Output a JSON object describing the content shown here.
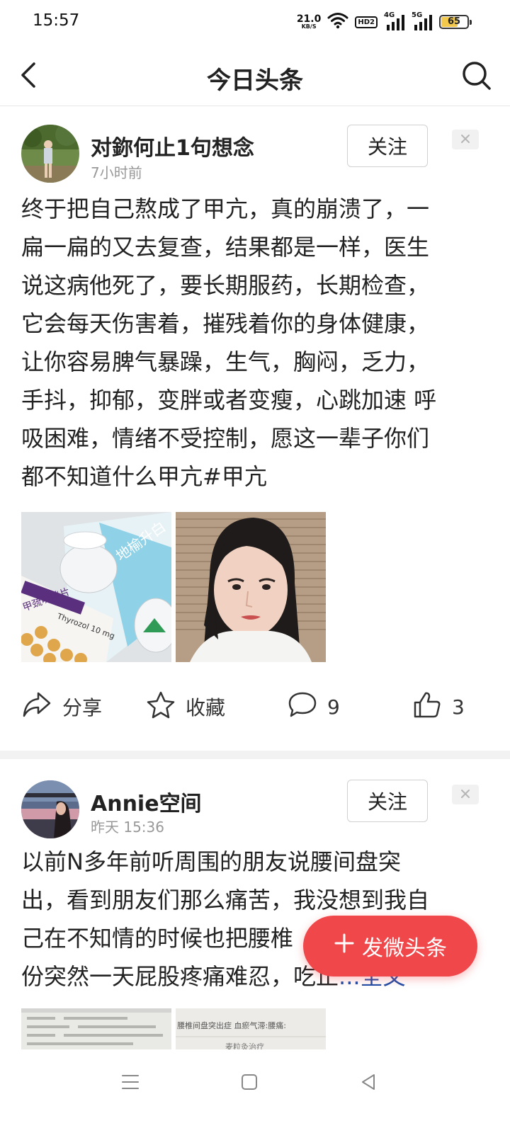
{
  "status_bar": {
    "time": "15:57",
    "net_speed": "21.0",
    "net_speed_unit": "KB/S",
    "hd_label": "HD2",
    "signal1_label": "4G",
    "signal2_label": "5G",
    "battery": "65"
  },
  "header": {
    "title": "今日头条",
    "back_icon": "chevron-left-icon",
    "search_icon": "search-icon"
  },
  "posts": [
    {
      "author": "对鉨何止1句想念",
      "time": "7小时前",
      "follow_label": "关注",
      "text_lines": [
        "终于把自己熬成了甲亢，真的崩溃了，一",
        "扁一扁的又去复查，结果都是一样，医生",
        "说这病他死了，要长期服药，长期检查，",
        "它会每天伤害着，摧残着你的身体健康，",
        "让你容易脾气暴躁，生气，胸闷，乏力，",
        "手抖，抑郁，变胖或者变瘦，心跳加速 呼",
        "吸困难，情绪不受控制，愿这一辈子你们",
        "都不知道什么甲亢#甲亢"
      ],
      "images": [
        {
          "name": "medicine-photo",
          "text1": "地榆升白",
          "text2": "甲巯咪唑片",
          "text3": "Thyrozol 10 mg"
        },
        {
          "name": "selfie-photo"
        }
      ],
      "actions": {
        "share": "分享",
        "favorite": "收藏",
        "comments": "9",
        "likes": "3"
      }
    },
    {
      "author": "Annie空间",
      "time": "昨天  15:36",
      "follow_label": "关注",
      "text_lines": [
        "以前N多年前听周围的朋友说腰间盘突",
        "出，看到朋友们那么痛苦，我没想到我自",
        "己在不知情的时候也把腰椎",
        "份突然一天屁股疼痛难忍，吃止"
      ],
      "more_ellipsis": "...",
      "more_label": "全文",
      "images": [
        {
          "name": "medical-report-photo"
        },
        {
          "name": "diagnosis-doc-photo",
          "text1": "腰椎间盘突出症  血瘀气滞:腰痛:",
          "text2": "麦粒灸治疗"
        }
      ]
    }
  ],
  "fab": {
    "label": "发微头条",
    "color": "#f0474b"
  },
  "navbar": {
    "menu_icon": "menu-icon",
    "home_icon": "home-square-icon",
    "back_icon": "back-triangle-icon"
  }
}
